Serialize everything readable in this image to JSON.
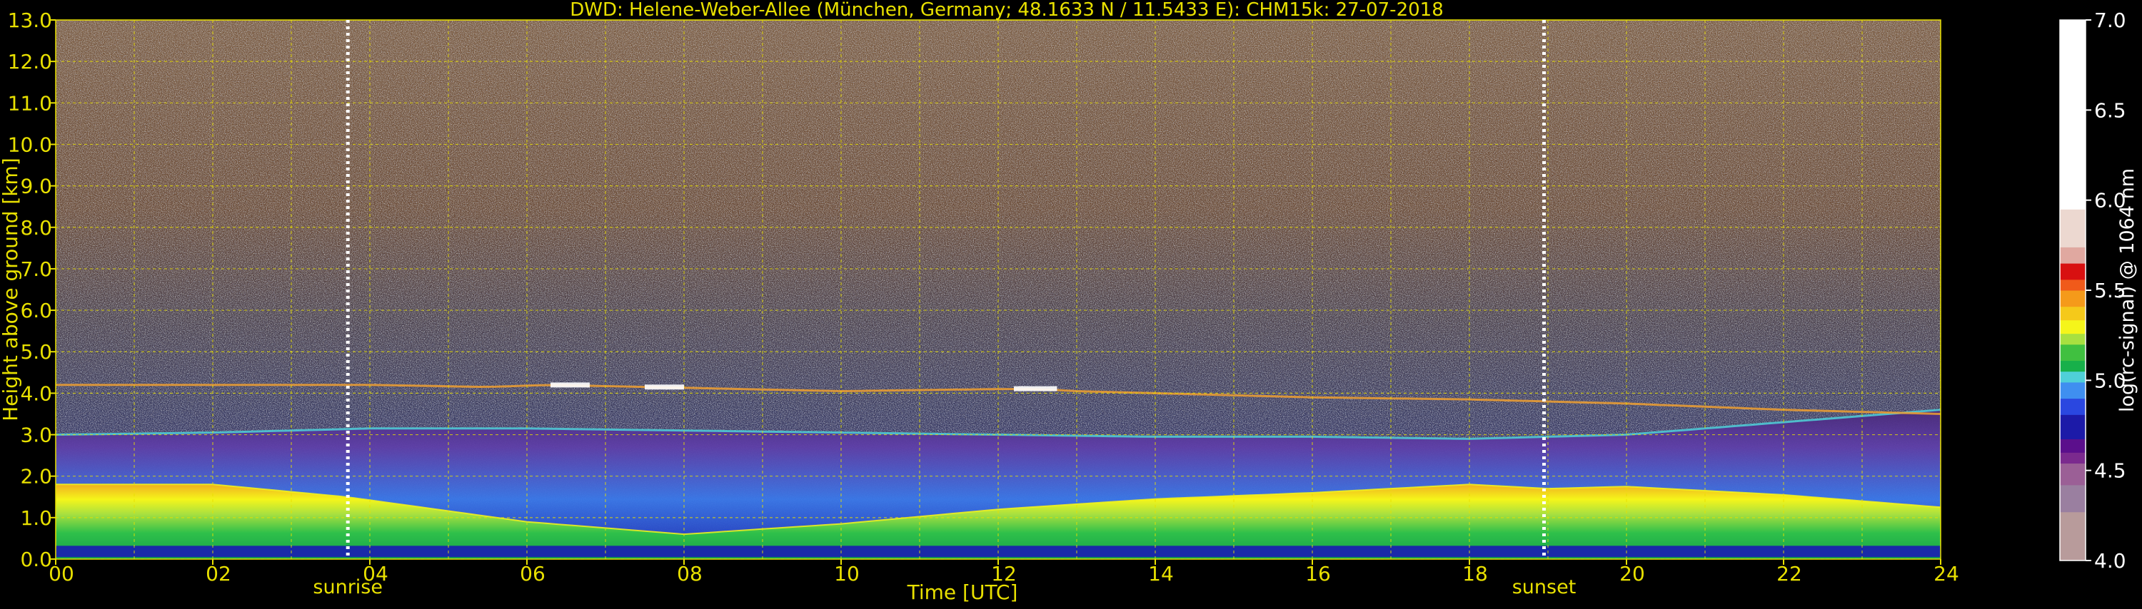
{
  "chart_data": {
    "type": "heatmap",
    "title": "DWD: Helene-Weber-Allee (München, Germany; 48.1633 N / 11.5433 E):    CHM15k: 27-07-2018",
    "xlabel": "Time [UTC]",
    "ylabel": "Height above ground [km]",
    "xlim": [
      0,
      24
    ],
    "ylim": [
      0,
      13
    ],
    "x_ticks": [
      "00",
      "02",
      "04",
      "06",
      "08",
      "10",
      "12",
      "14",
      "16",
      "18",
      "20",
      "22",
      "24"
    ],
    "y_ticks": [
      "0.0",
      "1.0",
      "2.0",
      "3.0",
      "4.0",
      "5.0",
      "6.0",
      "7.0",
      "8.0",
      "9.0",
      "10.0",
      "11.0",
      "12.0",
      "13.0"
    ],
    "grid": true,
    "annotations": [
      {
        "text": "sunrise",
        "x": 3.72
      },
      {
        "text": "sunset",
        "x": 18.95
      }
    ],
    "colorbar": {
      "label": "log(rc-signal) @ 1064 nm",
      "range": [
        4.0,
        7.0
      ],
      "ticks": [
        "4.0",
        "4.5",
        "5.0",
        "5.5",
        "6.0",
        "6.5",
        "7.0"
      ],
      "colors": [
        "#b89b9b",
        "#9a7fa0",
        "#9b5f96",
        "#7b2a8e",
        "#5b0f8c",
        "#1c1aa8",
        "#2a47e0",
        "#3f8ff0",
        "#4fd0d8",
        "#17b04a",
        "#40c040",
        "#a8e040",
        "#f5f51a",
        "#f5c91a",
        "#f59a1a",
        "#f05a1a",
        "#d81010",
        "#e0a8a0",
        "#ecd8d0",
        "#ffffff"
      ]
    },
    "layers": [
      {
        "name": "boundary_layer_top_km",
        "x": [
          0,
          2,
          3.7,
          6,
          8,
          10,
          12,
          14,
          16,
          18,
          19,
          20,
          22,
          24
        ],
        "y": [
          1.8,
          1.8,
          1.5,
          0.9,
          0.6,
          0.85,
          1.2,
          1.45,
          1.6,
          1.8,
          1.7,
          1.75,
          1.55,
          1.25
        ]
      },
      {
        "name": "residual_layer_top_km",
        "x": [
          0,
          2,
          4,
          6,
          8,
          10,
          12,
          14,
          16,
          18,
          20,
          22,
          24
        ],
        "y": [
          3.0,
          3.05,
          3.15,
          3.15,
          3.1,
          3.05,
          3.0,
          2.95,
          2.95,
          2.9,
          3.0,
          3.3,
          3.6
        ]
      },
      {
        "name": "cloud_layer_km",
        "x": [
          0,
          4,
          5.5,
          6.3,
          7.5,
          10,
          12,
          12.5,
          13,
          14,
          16,
          18,
          20,
          22,
          24
        ],
        "y": [
          4.2,
          4.2,
          4.15,
          4.2,
          4.15,
          4.05,
          4.1,
          4.1,
          4.05,
          4.0,
          3.9,
          3.85,
          3.75,
          3.6,
          3.5
        ]
      }
    ]
  }
}
